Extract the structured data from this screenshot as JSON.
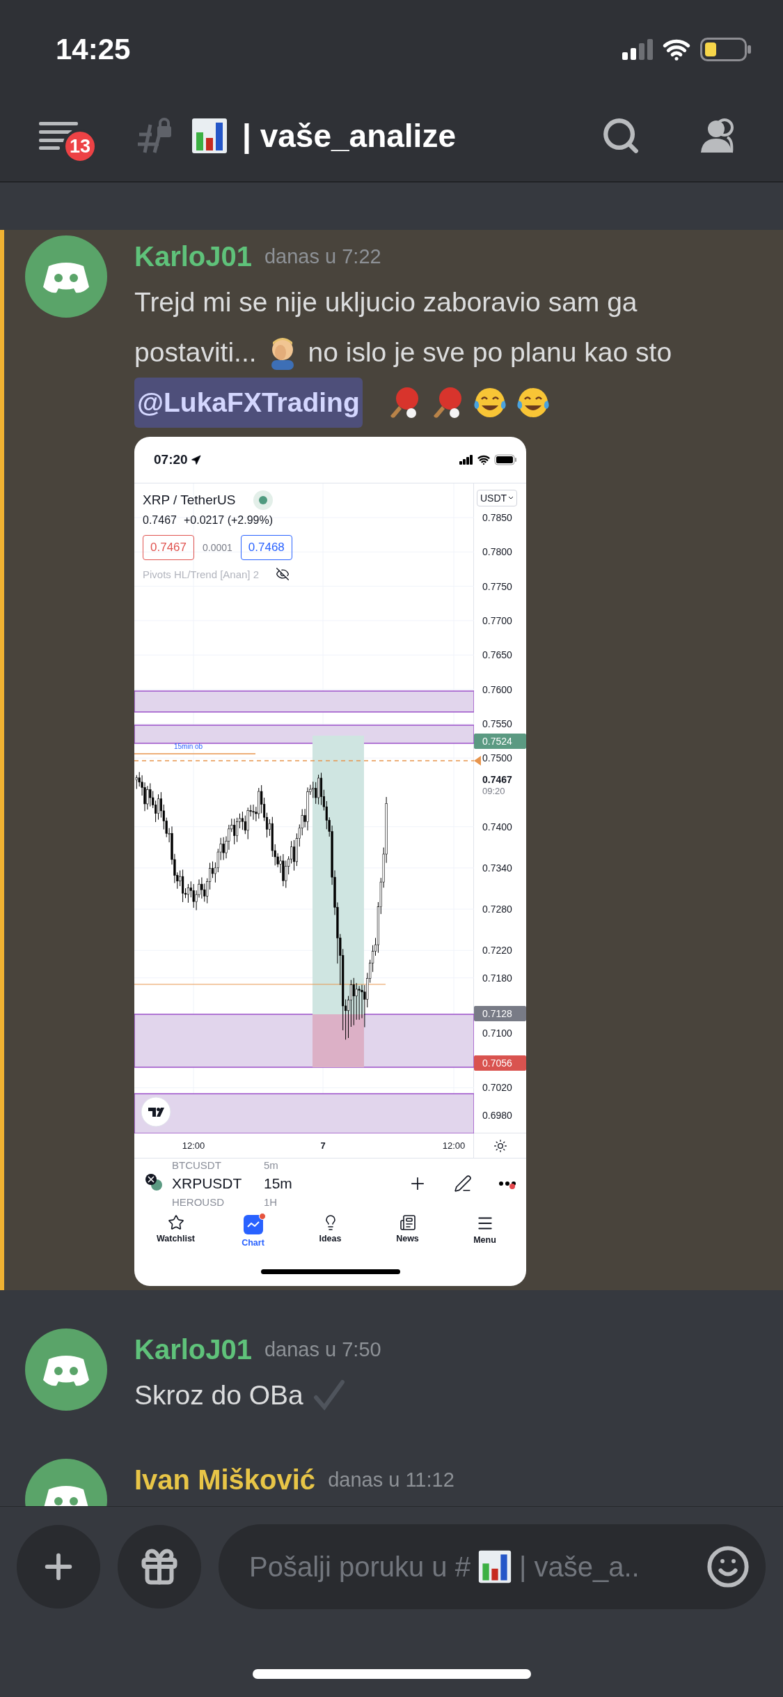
{
  "status_bar": {
    "time": "14:25"
  },
  "header": {
    "unread_count": "13",
    "channel_name": "| vaše_analize"
  },
  "messages": [
    {
      "author": "KarloJ01",
      "color": "#5fc27a",
      "time": "danas u 7:22",
      "mentioned": true,
      "lines": [
        [
          {
            "kind": "text",
            "text": "Trejd mi se nije ukljucio zaboravio sam ga"
          }
        ],
        [
          {
            "kind": "text",
            "text": "postaviti..."
          },
          {
            "kind": "facepalm"
          },
          {
            "kind": "text",
            "text": "no islo je sve po planu kao sto"
          }
        ],
        [
          {
            "kind": "mention",
            "text": "@LukaFXTrading"
          },
          {
            "kind": "pingpong"
          },
          {
            "kind": "pingpong"
          },
          {
            "kind": "joy"
          },
          {
            "kind": "joy"
          }
        ]
      ],
      "attachment": {
        "status_time": "07:20",
        "symbol_title": "XRP / TetherUS",
        "last": "0.7467",
        "change": "+0.0217 (+2.99%)",
        "bid": "0.7467",
        "spread": "0.0001",
        "ask": "0.7468",
        "indicator": "Pivots HL/Trend [Anan] 2",
        "zone_label": "15min ob",
        "currency": "USDT",
        "price_axis": [
          {
            "label": "0.7850",
            "kind": "tick"
          },
          {
            "label": "0.7800",
            "kind": "tick"
          },
          {
            "label": "0.7750",
            "kind": "tick"
          },
          {
            "label": "0.7700",
            "kind": "tick"
          },
          {
            "label": "0.7650",
            "kind": "tick"
          },
          {
            "label": "0.7600",
            "kind": "tick"
          },
          {
            "label": "0.7550",
            "kind": "tick"
          },
          {
            "label": "0.7524",
            "kind": "tag",
            "color": "#5b9a82"
          },
          {
            "label": "0.7500",
            "kind": "tick"
          },
          {
            "label": "0.7467",
            "kind": "last",
            "time": "09:20"
          },
          {
            "label": "0.7400",
            "kind": "tick"
          },
          {
            "label": "0.7340",
            "kind": "tick"
          },
          {
            "label": "0.7280",
            "kind": "tick"
          },
          {
            "label": "0.7220",
            "kind": "tick"
          },
          {
            "label": "0.7180",
            "kind": "tick"
          },
          {
            "label": "0.7128",
            "kind": "tag",
            "color": "#787b86"
          },
          {
            "label": "0.7100",
            "kind": "tick"
          },
          {
            "label": "0.7056",
            "kind": "tag",
            "color": "#d9534f"
          },
          {
            "label": "0.7020",
            "kind": "tick"
          },
          {
            "label": "0.6980",
            "kind": "tick"
          }
        ],
        "time_axis": [
          {
            "label": "12:00",
            "kind": "time"
          },
          {
            "label": "7",
            "kind": "day"
          },
          {
            "label": "12:00",
            "kind": "time"
          }
        ],
        "symbols": [
          {
            "symbol": "BTCUSDT",
            "interval": "5m",
            "selected": false
          },
          {
            "symbol": "XRPUSDT",
            "interval": "15m",
            "selected": true
          },
          {
            "symbol": "HEROUSD",
            "interval": "1H",
            "selected": false
          }
        ],
        "tabs": [
          {
            "label": "Watchlist",
            "selected": false,
            "dot": false
          },
          {
            "label": "Chart",
            "selected": true,
            "dot": true
          },
          {
            "label": "Ideas",
            "selected": false,
            "dot": false
          },
          {
            "label": "News",
            "selected": false,
            "dot": false
          },
          {
            "label": "Menu",
            "selected": false,
            "dot": false
          }
        ]
      }
    },
    {
      "author": "KarloJ01",
      "color": "#5fc27a",
      "time": "danas u 7:50",
      "mentioned": false,
      "lines": [
        [
          {
            "kind": "text",
            "text": "Skroz do OBa"
          },
          {
            "kind": "check"
          }
        ]
      ]
    },
    {
      "author": "Ivan Mišković",
      "color": "#e8c547",
      "time": "danas u 11:12",
      "mentioned": false
    }
  ],
  "composer": {
    "placeholder_start": "Pošalji poruku u #",
    "placeholder_end": "| vaše_a.."
  }
}
